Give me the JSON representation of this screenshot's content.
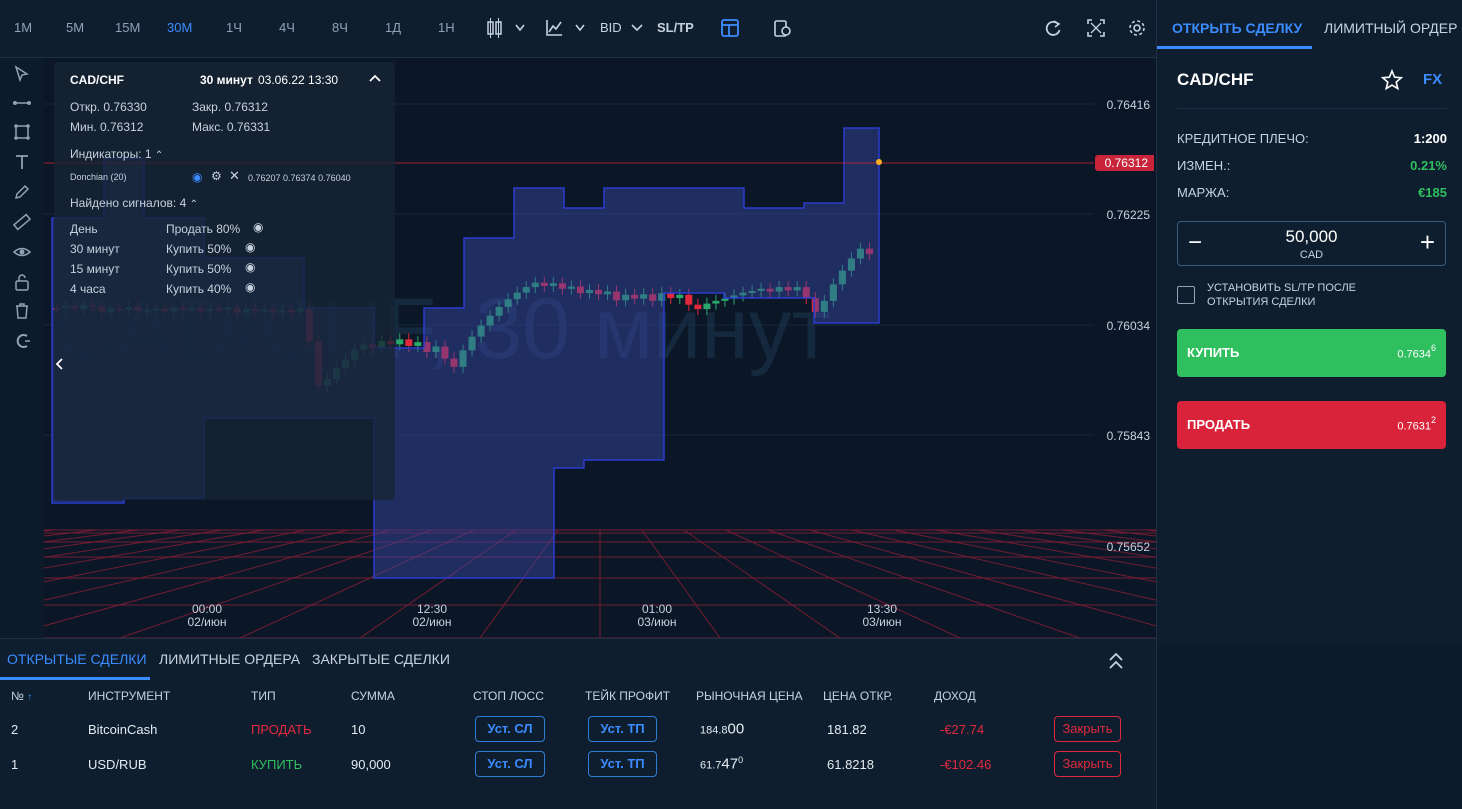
{
  "toolbar": {
    "timeframes": [
      "1M",
      "5M",
      "15M",
      "30M",
      "1Ч",
      "4Ч",
      "8Ч",
      "1Д",
      "1Н"
    ],
    "active_timeframe": "30M",
    "bid_label": "BID",
    "sltp_label": "SL/TP"
  },
  "chart": {
    "watermark": "CAD/CHF, 30 минут",
    "price_labels": [
      "0.76416",
      "0.76225",
      "0.76034",
      "0.75843",
      "0.75652"
    ],
    "current_price": "0.76312",
    "time_labels": [
      {
        "time": "00:00",
        "date": "02/июн"
      },
      {
        "time": "12:30",
        "date": "02/июн"
      },
      {
        "time": "01:00",
        "date": "03/июн"
      },
      {
        "time": "13:30",
        "date": "03/июн"
      }
    ],
    "colors": {
      "up": "#2aa86b",
      "down": "#e0293f",
      "band": "#3a4aa8",
      "midline": "#2b3ccf"
    }
  },
  "info": {
    "symbol": "CAD/CHF",
    "period": "30 минут",
    "datetime": "03.06.22 13:30",
    "open": "Откр. 0.76330",
    "close": "Закр. 0.76312",
    "low": "Мин. 0.76312",
    "high": "Макс. 0.76331",
    "indicators_label": "Индикаторы: 1",
    "indicator_name": "Donchian (20)",
    "indicator_values": "0.76207 0.76374 0.76040",
    "signals_label": "Найдено сигналов: 4",
    "signals": [
      {
        "period": "День",
        "signal": "Продать 80%"
      },
      {
        "period": "30 минут",
        "signal": "Купить 50%"
      },
      {
        "period": "15 минут",
        "signal": "Купить 50%"
      },
      {
        "period": "4 часа",
        "signal": "Купить 40%"
      }
    ]
  },
  "panel": {
    "tabs": [
      "ОТКРЫТЬ СДЕЛКУ",
      "ЛИМИТНЫЙ ОРДЕР"
    ],
    "symbol": "CAD/CHF",
    "market": "FX",
    "leverage_label": "КРЕДИТНОЕ ПЛЕЧО:",
    "leverage_value": "1:200",
    "change_label": "ИЗМЕН.:",
    "change_value": "0.21%",
    "margin_label": "МАРЖА:",
    "margin_value": "€185",
    "amount_value": "50,000",
    "amount_currency": "CAD",
    "sltp_checkbox_label": "УСТАНОВИТЬ SL/TP ПОСЛЕ ОТКРЫТИЯ СДЕЛКИ",
    "buy_label": "КУПИТЬ",
    "buy_price_main": "0.7634",
    "buy_price_sup": "6",
    "sell_label": "ПРОДАТЬ",
    "sell_price_main": "0.7631",
    "sell_price_sup": "2",
    "colors": {
      "buy": "#2fbf5f",
      "sell": "#d9233a",
      "accent": "#3b8cff",
      "positive": "#2fbf5f"
    }
  },
  "trades": {
    "tabs": [
      "ОТКРЫТЫЕ СДЕЛКИ",
      "ЛИМИТНЫЕ ОРДЕРА",
      "ЗАКРЫТЫЕ СДЕЛКИ"
    ],
    "columns": [
      "№",
      "ИНСТРУМЕНТ",
      "ТИП",
      "СУММА",
      "СТОП ЛОСС",
      "ТЕЙК ПРОФИТ",
      "РЫНОЧНАЯ ЦЕНА",
      "ЦЕНА ОТКР.",
      "ДОХОД"
    ],
    "rows": [
      {
        "id": "2",
        "instrument": "BitcoinCash",
        "type": "ПРОДАТЬ",
        "amount": "10",
        "sl": "Уст. СЛ",
        "tp": "Уст. ТП",
        "market_main": "184.8",
        "market_big": "00",
        "market_sup": "",
        "open_price": "181.82",
        "profit": "-€27.74",
        "close": "Закрыть"
      },
      {
        "id": "1",
        "instrument": "USD/RUB",
        "type": "КУПИТЬ",
        "amount": "90,000",
        "sl": "Уст. СЛ",
        "tp": "Уст. ТП",
        "market_main": "61.7",
        "market_big": "47",
        "market_sup": "0",
        "open_price": "61.8218",
        "profit": "-€102.46",
        "close": "Закрыть"
      }
    ]
  }
}
